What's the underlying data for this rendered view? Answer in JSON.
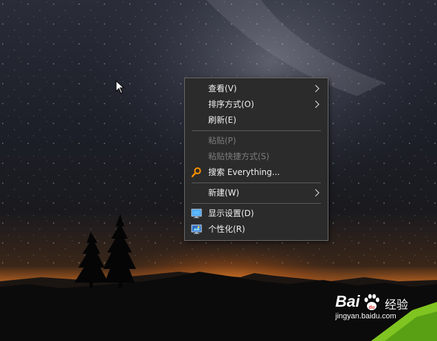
{
  "desktop": {
    "wallpaper": "night-sky-milky-way-mountain-sunset",
    "colors": {
      "sky": "#1a1d28",
      "horizon_glow": "#e07a2a",
      "ground": "#0a0a0c"
    }
  },
  "context_menu": {
    "items": [
      {
        "label": "查看(V)",
        "enabled": true,
        "submenu": true,
        "icon": null
      },
      {
        "label": "排序方式(O)",
        "enabled": true,
        "submenu": true,
        "icon": null
      },
      {
        "label": "刷新(E)",
        "enabled": true,
        "submenu": false,
        "icon": null
      },
      {
        "label": "粘贴(P)",
        "enabled": false,
        "submenu": false,
        "icon": null
      },
      {
        "label": "粘贴快捷方式(S)",
        "enabled": false,
        "submenu": false,
        "icon": null
      },
      {
        "label": "搜索 Everything...",
        "enabled": true,
        "submenu": false,
        "icon": "magnifier-icon"
      },
      {
        "label": "新建(W)",
        "enabled": true,
        "submenu": true,
        "icon": null
      },
      {
        "label": "显示设置(D)",
        "enabled": true,
        "submenu": false,
        "icon": "display-settings-icon"
      },
      {
        "label": "个性化(R)",
        "enabled": true,
        "submenu": false,
        "icon": "personalize-icon"
      }
    ],
    "colors": {
      "background": "#2b2b2b",
      "text": "#f2f2f2",
      "disabled_text": "#7c7c7c",
      "separator": "#5c5c5c"
    }
  },
  "cursor": {
    "icon": "arrow-cursor-icon"
  },
  "watermark": {
    "logo": "Bai",
    "title": "经验",
    "url": "jingyan.baidu.com"
  }
}
